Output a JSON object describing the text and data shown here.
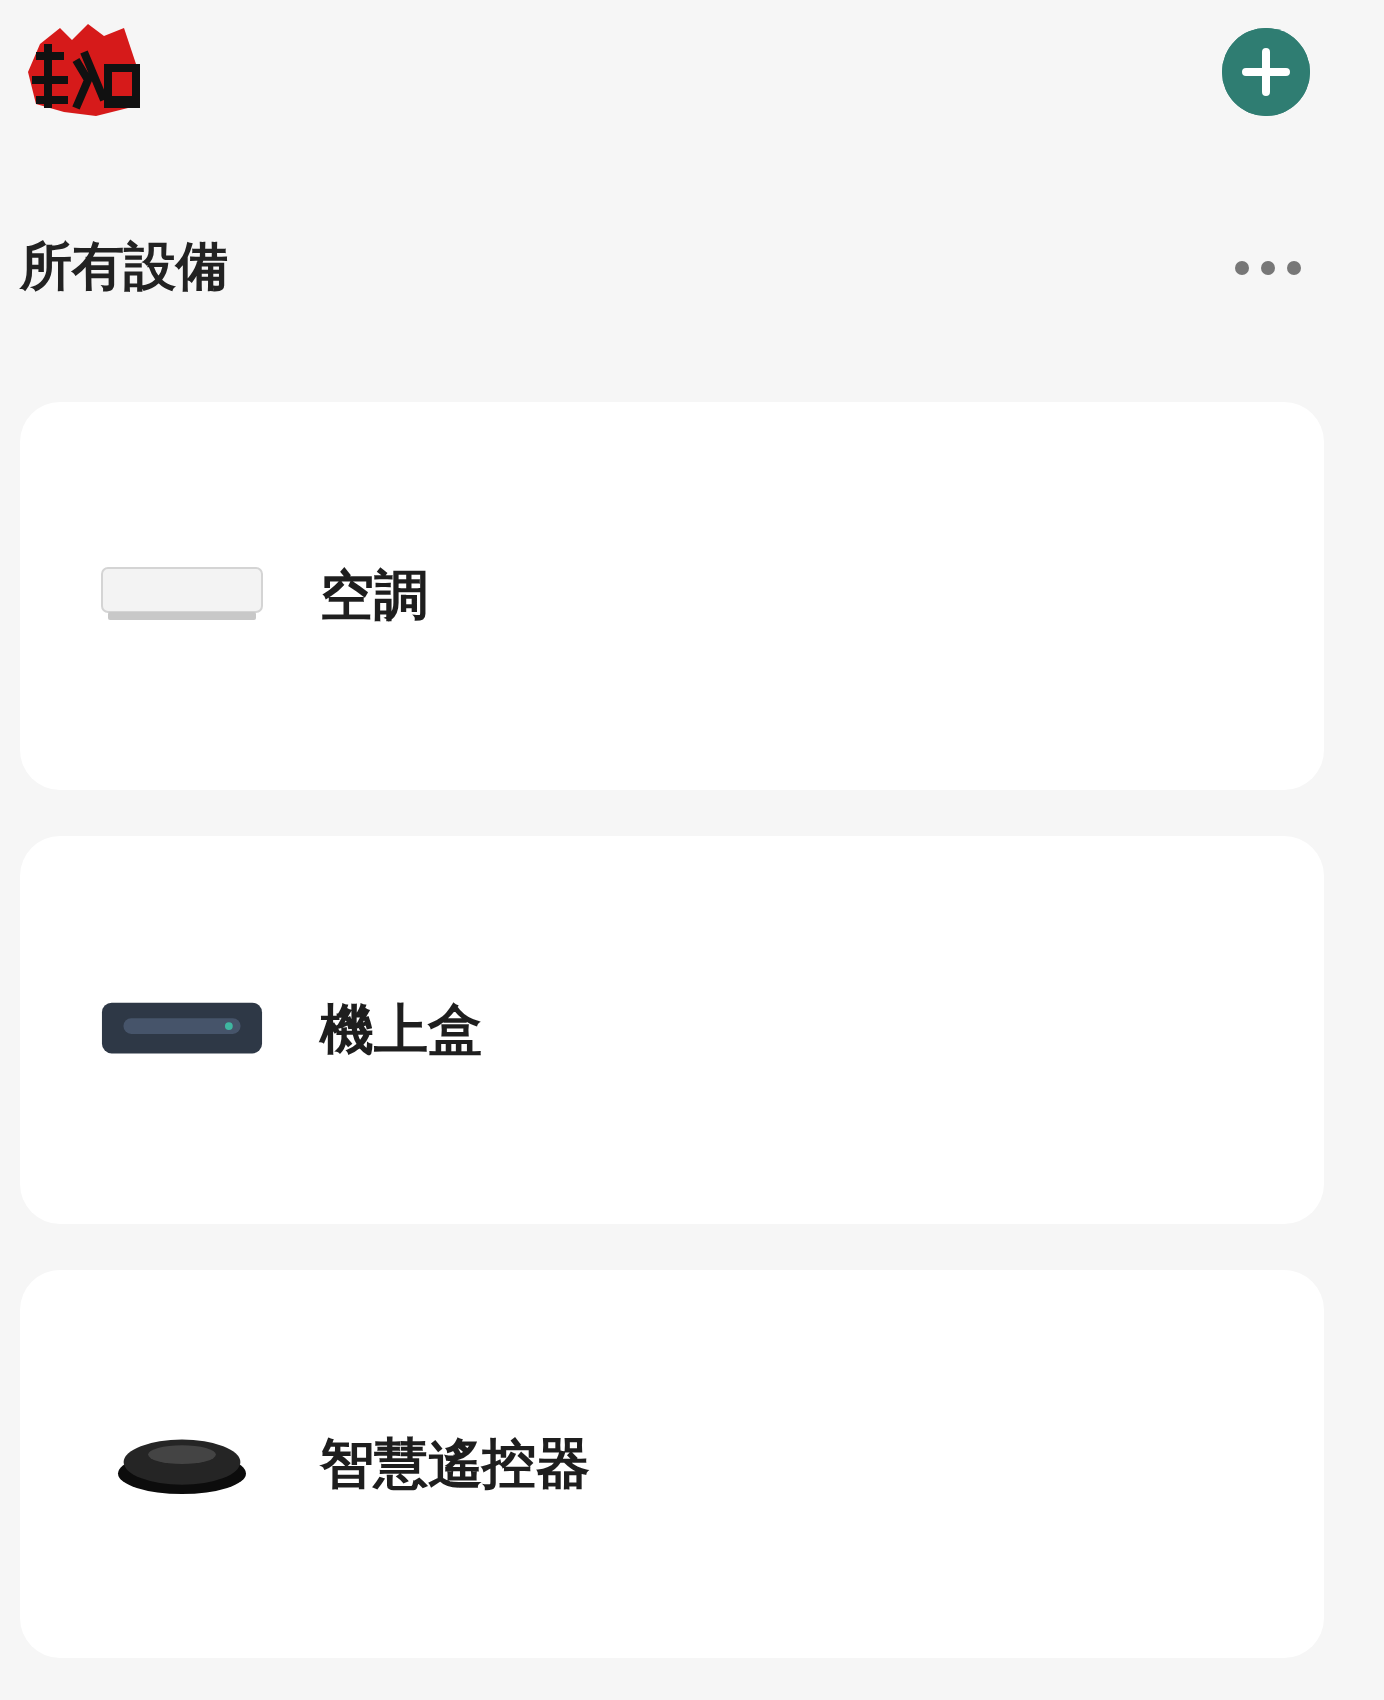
{
  "header": {
    "title": "所有設備"
  },
  "devices": [
    {
      "name": "空調",
      "kind": "ac"
    },
    {
      "name": "機上盒",
      "kind": "stb"
    },
    {
      "name": "智慧遙控器",
      "kind": "hub"
    }
  ]
}
